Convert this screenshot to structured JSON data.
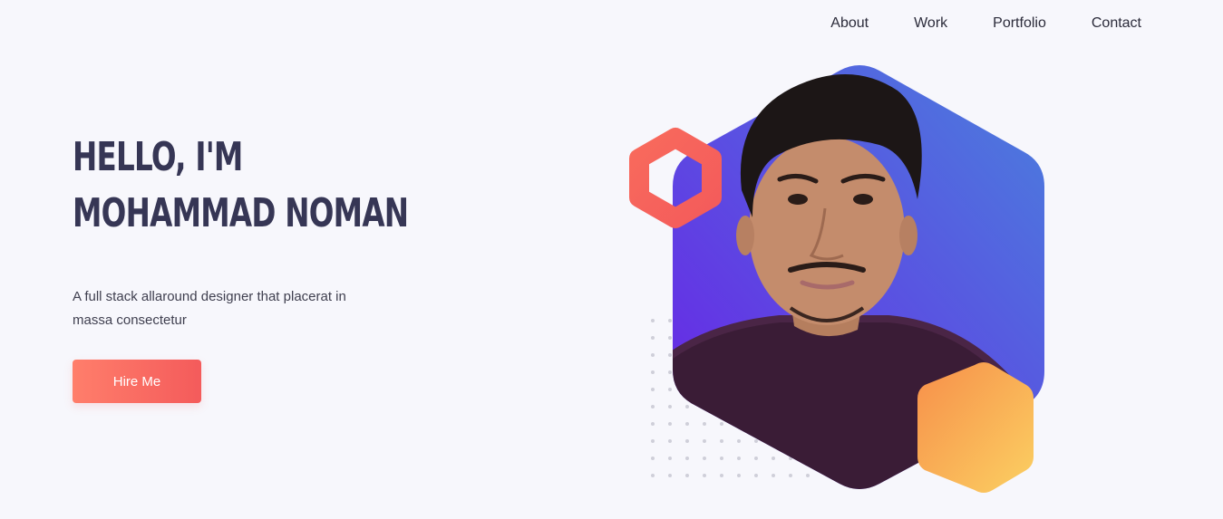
{
  "nav": {
    "items": [
      {
        "label": "About"
      },
      {
        "label": "Work"
      },
      {
        "label": "Portfolio"
      },
      {
        "label": "Contact"
      }
    ]
  },
  "hero": {
    "title_line1": "HELLO, I'M",
    "title_line2": "MOHAMMAD NOMAN",
    "subtitle": "A full stack allaround designer that placerat in massa consectetur",
    "cta_label": "Hire Me"
  },
  "colors": {
    "background": "#f7f7fc",
    "heading": "#363655",
    "accent_coral": "#f45b5b",
    "hexagon_purple": "#6a27e6",
    "hexagon_blue": "#4a78e0",
    "hexagon_orange": "#f9a34a"
  }
}
